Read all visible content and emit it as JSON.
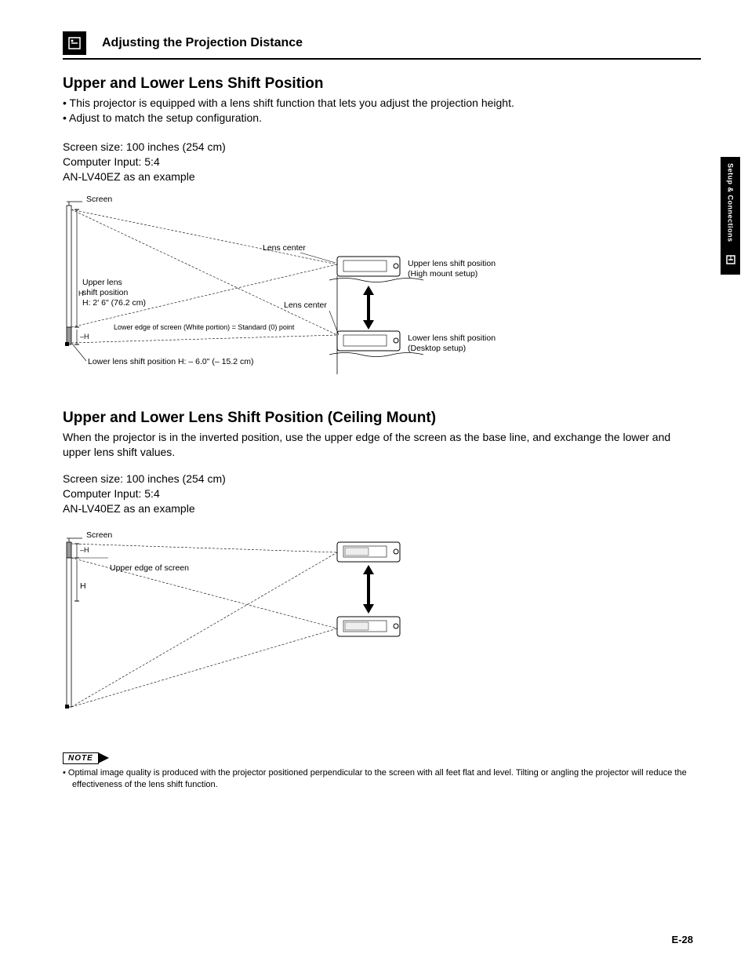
{
  "header": {
    "title": "Adjusting the Projection Distance"
  },
  "sideTab": {
    "label": "Setup & Connections"
  },
  "section1": {
    "title": "Upper and Lower Lens Shift Position",
    "bullets": [
      "This projector is equipped with a lens shift function that lets you adjust the projection height.",
      "Adjust to match the setup configuration."
    ],
    "specs": {
      "line1": "Screen size: 100 inches (254 cm)",
      "line2": "Computer Input: 5:4",
      "line3": "AN-LV40EZ as an example"
    },
    "diagram": {
      "screen": "Screen",
      "lensCenter1": "Lens center",
      "lensCenter2": "Lens center",
      "upperPos": "Upper lens shift position",
      "upperSetup": "(High mount setup)",
      "lowerPos": "Lower lens shift position",
      "lowerSetup": "(Desktop setup)",
      "upperLabel1": "Upper lens",
      "upperLabel2": "shift position",
      "upperLabel3": "H: 2' 6\" (76.2 cm)",
      "h1": "H",
      "h2": "–H",
      "lowerEdge": "Lower edge of screen (White portion)  = Standard (0) point",
      "lowerShift": "Lower lens shift position H: – 6.0\" (– 15.2 cm)"
    }
  },
  "section2": {
    "title": "Upper and Lower Lens Shift Position (Ceiling Mount)",
    "body": "When the projector is in the inverted position, use the upper edge of the screen as the base line, and exchange the lower and upper lens shift values.",
    "specs": {
      "line1": "Screen size: 100 inches (254 cm)",
      "line2": "Computer Input: 5:4",
      "line3": "AN-LV40EZ as an example"
    },
    "diagram": {
      "screen": "Screen",
      "upperEdge": "Upper edge of screen",
      "h1": "–H",
      "h2": "H"
    }
  },
  "note": {
    "label": "NOTE",
    "items": [
      "Optimal image quality is produced with the projector positioned perpendicular to the screen with all feet flat and level. Tilting or angling the projector will reduce the effectiveness of the lens shift function."
    ]
  },
  "pageNumber": "E-28"
}
